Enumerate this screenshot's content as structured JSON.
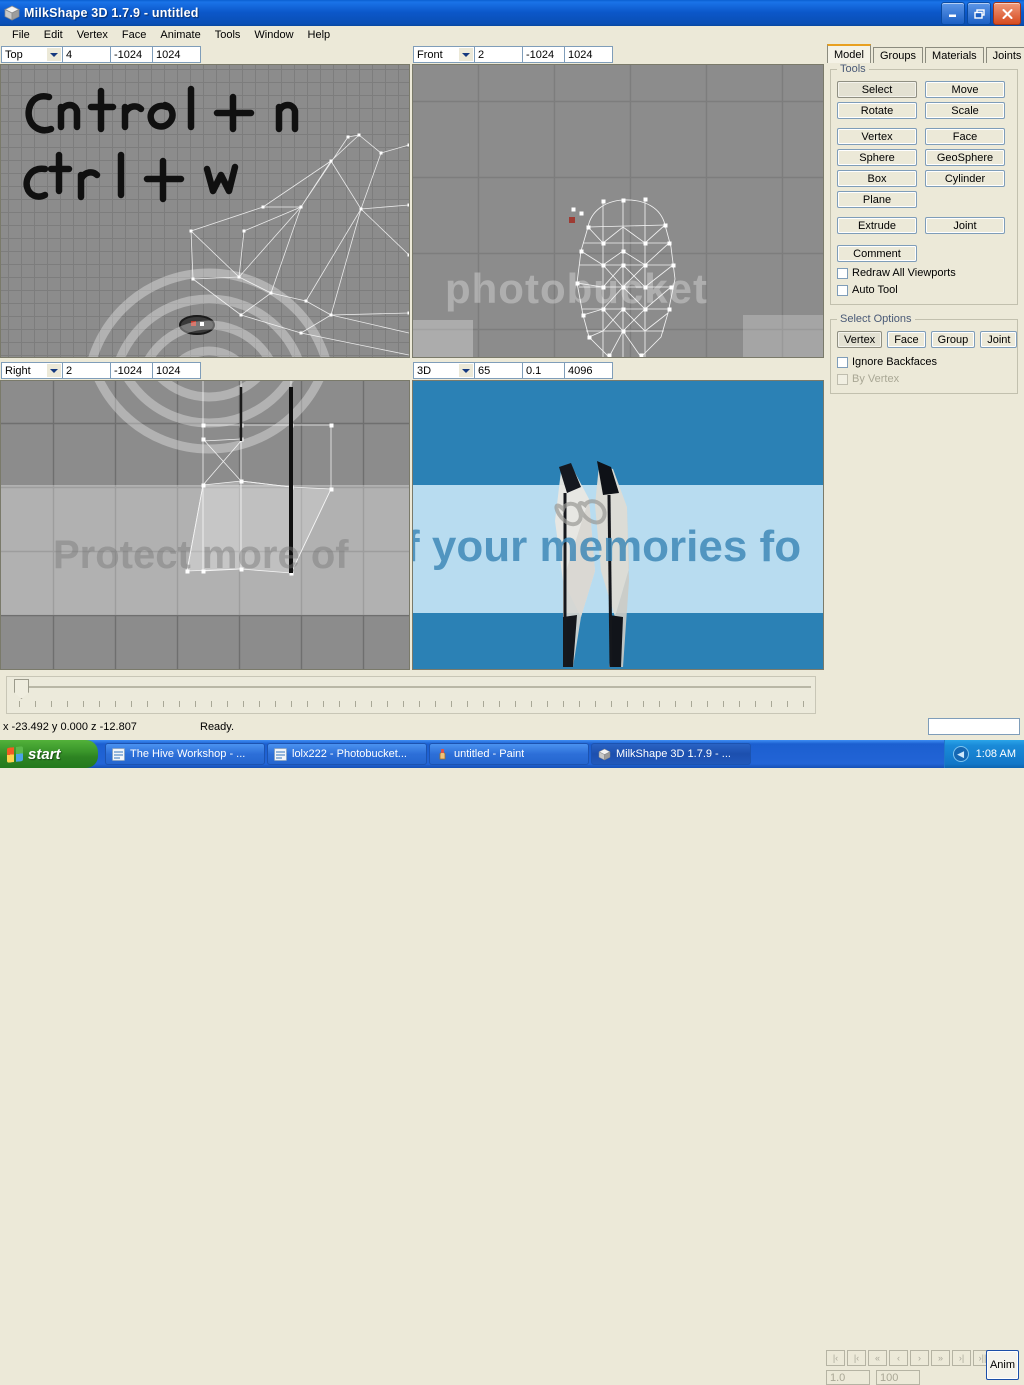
{
  "window": {
    "title": "MilkShape 3D 1.7.9 - untitled",
    "icon": "milkshape-cube-icon",
    "minimize_label": "_",
    "maximize_label": "❐",
    "close_label": "×",
    "titlebar_color": "#0b57c9"
  },
  "menu": {
    "items": [
      "File",
      "Edit",
      "Vertex",
      "Face",
      "Animate",
      "Tools",
      "Window",
      "Help"
    ]
  },
  "viewports": [
    {
      "name": "top",
      "view": "Top",
      "grid": "4",
      "near": "-1024",
      "far": "1024"
    },
    {
      "name": "front",
      "view": "Front",
      "grid": "2",
      "near": "-1024",
      "far": "1024"
    },
    {
      "name": "right",
      "view": "Right",
      "grid": "2",
      "near": "-1024",
      "far": "1024"
    },
    {
      "name": "persp",
      "view": "3D",
      "grid": "65",
      "near": "0.1",
      "far": "4096"
    }
  ],
  "annotation": {
    "line1": "Cntrol + n",
    "line2": "ctrl + w"
  },
  "watermark": {
    "brand": "photobucket",
    "tagline": "Protect more of your memories for less!"
  },
  "panel": {
    "tabs": [
      {
        "label": "Model",
        "active": true
      },
      {
        "label": "Groups",
        "active": false
      },
      {
        "label": "Materials",
        "active": false
      },
      {
        "label": "Joints",
        "active": false
      }
    ],
    "tools": {
      "title": "Tools",
      "buttons": [
        {
          "label": "Select",
          "pressed": true
        },
        {
          "label": "Move",
          "pressed": false
        },
        {
          "label": "Rotate",
          "pressed": false
        },
        {
          "label": "Scale",
          "pressed": false
        },
        {
          "label": "Vertex",
          "pressed": false
        },
        {
          "label": "Face",
          "pressed": false
        },
        {
          "label": "Sphere",
          "pressed": false
        },
        {
          "label": "GeoSphere",
          "pressed": false
        },
        {
          "label": "Box",
          "pressed": false
        },
        {
          "label": "Cylinder",
          "pressed": false
        },
        {
          "label": "Plane",
          "pressed": false
        },
        {
          "label": "Extrude",
          "pressed": false
        },
        {
          "label": "Joint",
          "pressed": false
        }
      ],
      "comment_label": "Comment",
      "checkboxes": [
        {
          "label": "Redraw All Viewports",
          "checked": false,
          "disabled": false
        },
        {
          "label": "Auto Tool",
          "checked": false,
          "disabled": false
        }
      ]
    },
    "select_options": {
      "title": "Select Options",
      "modes": [
        {
          "label": "Vertex",
          "pressed": true
        },
        {
          "label": "Face",
          "pressed": false
        },
        {
          "label": "Group",
          "pressed": false
        },
        {
          "label": "Joint",
          "pressed": false
        }
      ],
      "checkboxes": [
        {
          "label": "Ignore Backfaces",
          "checked": false,
          "disabled": false
        },
        {
          "label": "By Vertex",
          "checked": false,
          "disabled": true
        }
      ]
    }
  },
  "animation": {
    "buttons": [
      "|‹",
      "|‹",
      "«",
      "‹",
      "›",
      "»",
      "›|",
      "›||"
    ],
    "frame_start": "1.0",
    "frame_end": "100",
    "anim_label": "Anim",
    "command_value": ""
  },
  "status": {
    "coords": "x -23.492 y 0.000 z -12.807",
    "message": "Ready."
  },
  "taskbar": {
    "start_label": "start",
    "items": [
      {
        "label": "The Hive Workshop - ...",
        "icon": "ie-icon",
        "active": false
      },
      {
        "label": "lolx222 - Photobucket...",
        "icon": "ie-icon",
        "active": false
      },
      {
        "label": "untitled - Paint",
        "icon": "paint-icon",
        "active": false
      },
      {
        "label": "MilkShape 3D 1.7.9 - ...",
        "icon": "milkshape-icon",
        "active": true
      }
    ],
    "clock": "1:08 AM",
    "tray_icon": "volume-icon"
  }
}
